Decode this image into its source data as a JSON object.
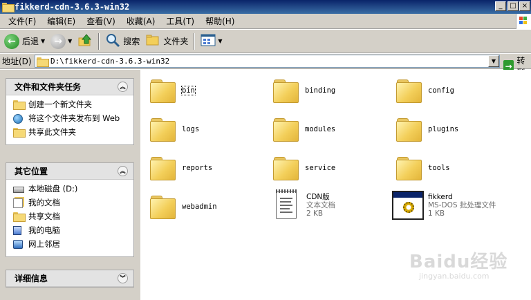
{
  "window": {
    "title": "fikkerd-cdn-3.6.3-win32"
  },
  "menubar": {
    "items": [
      "文件(F)",
      "编辑(E)",
      "查看(V)",
      "收藏(A)",
      "工具(T)",
      "帮助(H)"
    ]
  },
  "toolbar": {
    "back": "后退",
    "search": "搜索",
    "folders": "文件夹"
  },
  "address": {
    "label": "地址(D)",
    "path": "D:\\fikkerd-cdn-3.6.3-win32",
    "go": "转到"
  },
  "left_panel": {
    "tasks": {
      "title": "文件和文件夹任务",
      "items": [
        "创建一个新文件夹",
        "将这个文件夹发布到 Web",
        "共享此文件夹"
      ]
    },
    "other_places": {
      "title": "其它位置",
      "items": [
        "本地磁盘 (D:)",
        "我的文档",
        "共享文档",
        "我的电脑",
        "网上邻居"
      ]
    },
    "details": {
      "title": "详细信息"
    }
  },
  "files": [
    {
      "name": "bin",
      "type": "folder"
    },
    {
      "name": "binding",
      "type": "folder"
    },
    {
      "name": "config",
      "type": "folder"
    },
    {
      "name": "logs",
      "type": "folder"
    },
    {
      "name": "modules",
      "type": "folder"
    },
    {
      "name": "plugins",
      "type": "folder"
    },
    {
      "name": "reports",
      "type": "folder"
    },
    {
      "name": "service",
      "type": "folder"
    },
    {
      "name": "tools",
      "type": "folder"
    },
    {
      "name": "webadmin",
      "type": "folder"
    },
    {
      "name": "CDN版",
      "type": "text-file",
      "kind": "文本文档",
      "size": "2 KB"
    },
    {
      "name": "fikkerd",
      "type": "batch-file",
      "kind": "MS-DOS 批处理文件",
      "size": "1 KB"
    }
  ],
  "watermark": {
    "main": "Baidu经验",
    "sub": "jingyan.baidu.com"
  },
  "colors": {
    "titlebar": "#0a246a",
    "chrome": "#d4d0c8",
    "folder": "#f3cf5a"
  }
}
